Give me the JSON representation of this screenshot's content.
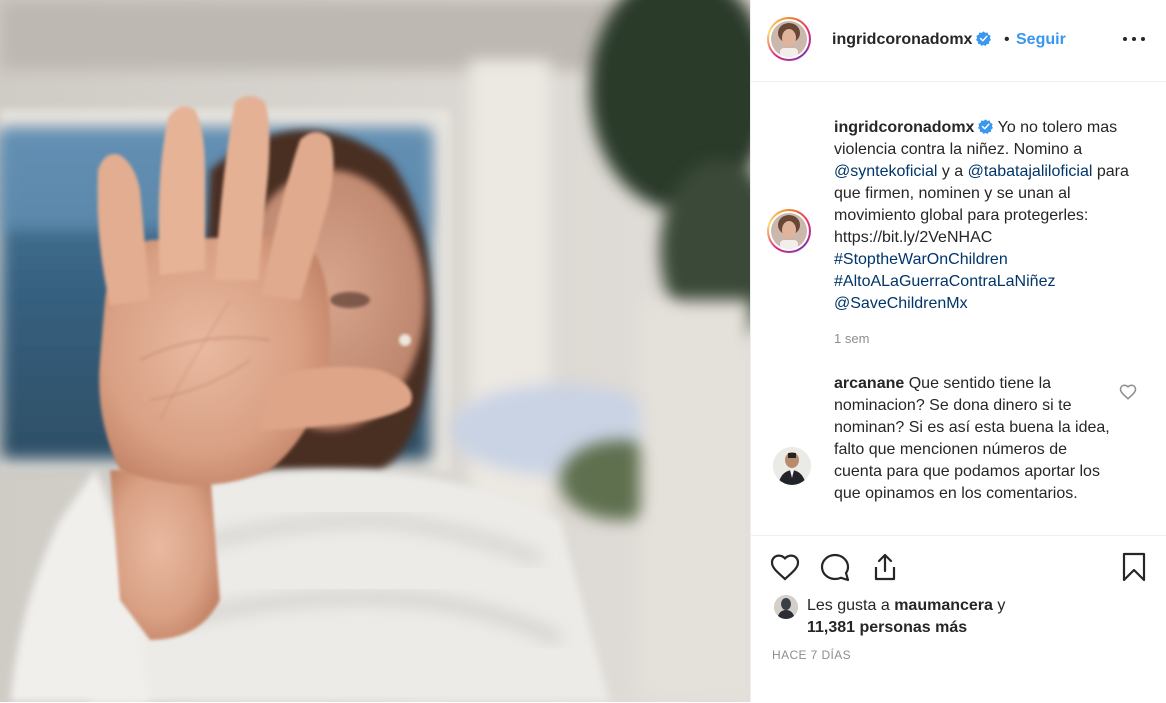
{
  "post": {
    "username": "ingridcoronadomx",
    "follow_label": "Seguir",
    "dot": "•",
    "more_label": "Más opciones",
    "caption": {
      "username": "ingridcoronadomx",
      "text_1": "Yo no tolero mas violencia contra la niñez. Nomino a",
      "mention_1": "@syntekoficial",
      "text_2": "y a",
      "mention_2": "@tabatajaliloficial",
      "text_3": "para que firmen, nominen y se unan al movimiento global para protegerles: https://bit.ly/2VeNHAC",
      "hashtag_1": "#StoptheWarOnChildren",
      "hashtag_2": "#AltoALaGuerraContraLaNiñez",
      "mention_3": "@SaveChildrenMx",
      "time": "1 sem"
    },
    "comments": [
      {
        "username": "arcanane",
        "text": "Que sentido tiene la nominacion? Se dona dinero si te nominan? Si es así esta buena la idea, falto que mencionen números de cuenta para que podamos aportar los que opinamos en los comentarios."
      }
    ],
    "likes": {
      "prefix": "Les gusta a",
      "liker": "maumancera",
      "connector": "y",
      "others": "11,381 personas más"
    },
    "posted_ago": "HACE 7 DÍAS",
    "icons": {
      "like": "heart-icon",
      "comment": "comment-icon",
      "share": "share-icon",
      "save": "bookmark-icon",
      "verified": "verified-badge-icon",
      "more": "more-options-icon"
    },
    "colors": {
      "link": "#003569",
      "follow": "#3897f0",
      "verified": "#3897f0",
      "muted": "#8e8e8e"
    }
  }
}
